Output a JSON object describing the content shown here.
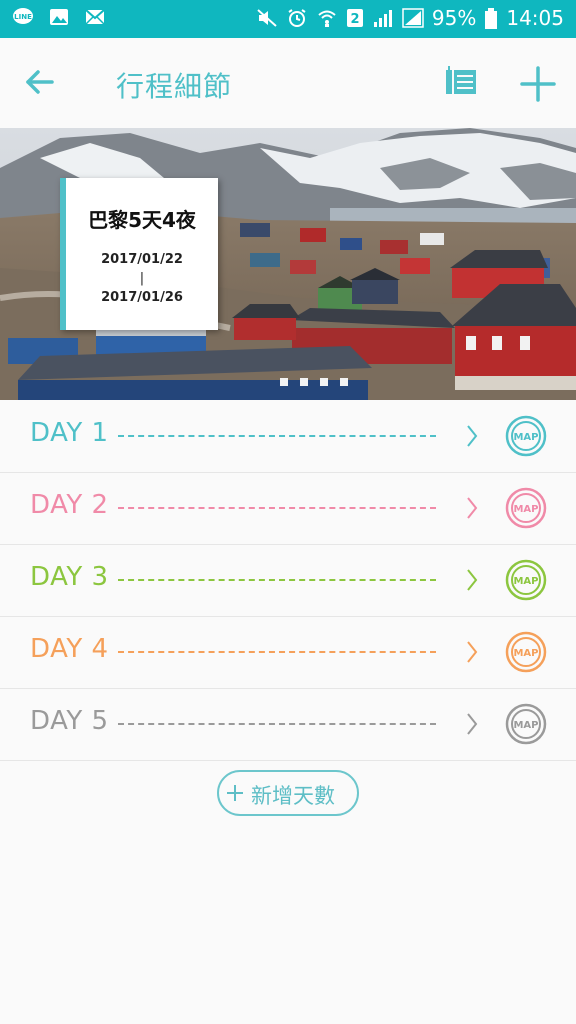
{
  "status_bar": {
    "battery_text": "95%",
    "time": "14:05",
    "sim_slot": "2",
    "color": "#0fb7bf"
  },
  "app_bar": {
    "title": "行程細節",
    "accent_color": "#4fc0c8",
    "back_icon": "back-arrow-icon",
    "list_icon": "list-icon",
    "add_icon": "plus-icon"
  },
  "trip": {
    "title": "巴黎5天4夜",
    "start_date": "2017/01/22",
    "separator": "|",
    "end_date": "2017/01/26"
  },
  "days": [
    {
      "label": "DAY 1",
      "color": "#4fc0c8",
      "map_label": "MAP"
    },
    {
      "label": "DAY 2",
      "color": "#f08aa8",
      "map_label": "MAP"
    },
    {
      "label": "DAY 3",
      "color": "#8cc63f",
      "map_label": "MAP"
    },
    {
      "label": "DAY 4",
      "color": "#f5a05a",
      "map_label": "MAP"
    },
    {
      "label": "DAY 5",
      "color": "#9a9a9a",
      "map_label": "MAP"
    }
  ],
  "add_day": {
    "plus": "+",
    "label": "新增天數"
  }
}
